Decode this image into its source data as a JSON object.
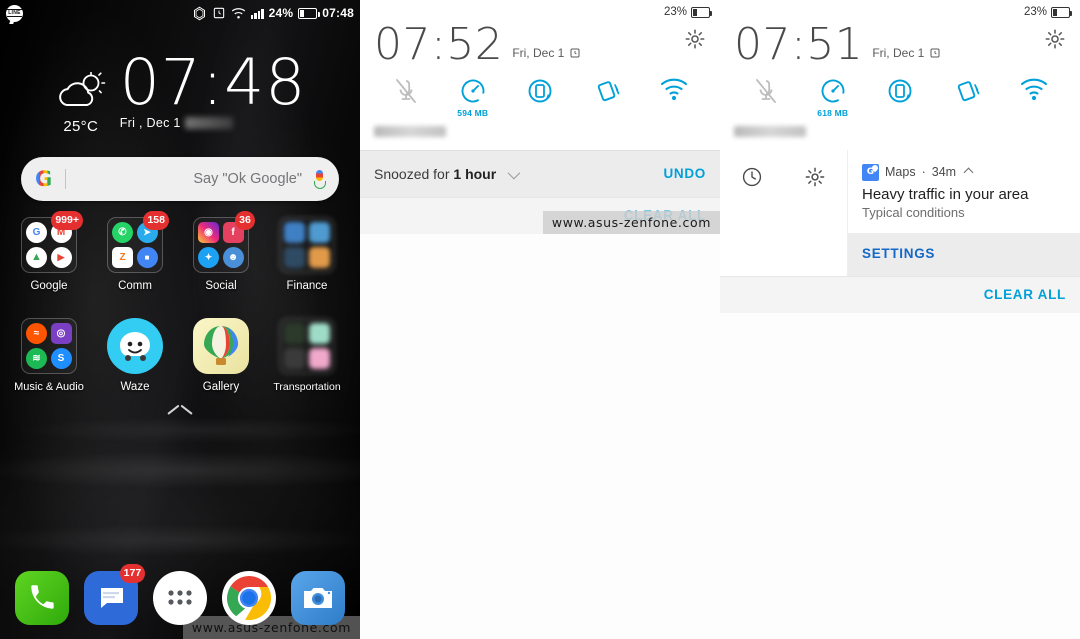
{
  "home": {
    "statusbar": {
      "notification_icon": "line-icon",
      "icons": [
        "do-not-disturb-icon",
        "alarm-icon",
        "wifi-icon",
        "signal-icon"
      ],
      "battery_percent": "24%",
      "time": "07:48"
    },
    "widget": {
      "weather_icon": "partly-cloudy-icon",
      "temperature": "25°C",
      "time": "07:48",
      "date": "Fri , Dec 1"
    },
    "search": {
      "logo": "google-g-icon",
      "placeholder": "Say \"Ok Google\"",
      "mic_icon": "microphone-icon"
    },
    "rows": [
      [
        {
          "label": "Google",
          "type": "folder",
          "badge": "999+",
          "minis": [
            {
              "name": "google-icon",
              "bg": "#ffffff",
              "fg": "#4285f4",
              "glyph": "G"
            },
            {
              "name": "gmail-icon",
              "bg": "#ffffff",
              "fg": "#ea4335",
              "glyph": "M"
            },
            {
              "name": "drive-icon",
              "bg": "#ffffff",
              "fg": "#34a853",
              "glyph": "▲"
            },
            {
              "name": "play-icon",
              "bg": "#ffffff",
              "fg": "#ea4335",
              "glyph": "▶"
            }
          ]
        },
        {
          "label": "Comm",
          "type": "folder",
          "badge": "158",
          "minis": [
            {
              "name": "whatsapp-icon",
              "bg": "#25d366",
              "fg": "#ffffff",
              "glyph": "✆"
            },
            {
              "name": "telegram-icon",
              "bg": "#2aabee",
              "fg": "#ffffff",
              "glyph": "➤"
            },
            {
              "name": "zalo-icon",
              "bg": "#ffffff",
              "fg": "#f47b20",
              "glyph": "Z"
            },
            {
              "name": "duo-icon",
              "bg": "#4285f4",
              "fg": "#ffffff",
              "glyph": "■"
            }
          ]
        },
        {
          "label": "Social",
          "type": "folder",
          "badge": "36",
          "minis": [
            {
              "name": "instagram-icon",
              "bg": "#d6306e",
              "fg": "#ffffff",
              "glyph": "◉"
            },
            {
              "name": "facebook-icon",
              "bg": "#e4405f",
              "fg": "#ffffff",
              "glyph": "f"
            },
            {
              "name": "twitter-icon",
              "bg": "#1da1f2",
              "fg": "#ffffff",
              "glyph": "✦"
            },
            {
              "name": "reddit-icon",
              "bg": "#4a90d9",
              "fg": "#ffffff",
              "glyph": "☻"
            }
          ]
        },
        {
          "label": "Finance",
          "type": "folder",
          "badge": "",
          "minis": [
            {
              "name": "finance-app-icon",
              "bg": "#3f7fc4",
              "fg": "#ffffff",
              "glyph": ""
            },
            {
              "name": "finance-app-icon",
              "bg": "#4f9ad0",
              "fg": "#ffffff",
              "glyph": ""
            },
            {
              "name": "finance-app-icon",
              "bg": "#2f4a63",
              "fg": "#ffffff",
              "glyph": ""
            },
            {
              "name": "finance-app-icon",
              "bg": "#e09a4a",
              "fg": "#ffffff",
              "glyph": ""
            }
          ]
        }
      ],
      [
        {
          "label": "Music & Audio",
          "type": "folder",
          "badge": "",
          "minis": [
            {
              "name": "soundcloud-icon",
              "bg": "#ff5500",
              "fg": "#ffffff",
              "glyph": "≈"
            },
            {
              "name": "podcast-icon",
              "bg": "#7b3fc4",
              "fg": "#ffffff",
              "glyph": "◎"
            },
            {
              "name": "spotify-icon",
              "bg": "#1db954",
              "fg": "#ffffff",
              "glyph": "≋"
            },
            {
              "name": "shazam-icon",
              "bg": "#1f8fff",
              "fg": "#ffffff",
              "glyph": "S"
            }
          ]
        },
        {
          "label": "Waze",
          "type": "app",
          "icon": "waze-icon",
          "bg": "#33ccf3",
          "glyph": "☺"
        },
        {
          "label": "Gallery",
          "type": "app",
          "icon": "gallery-icon",
          "bg": "#f3efbf",
          "glyph": ""
        },
        {
          "label": "Transportation",
          "type": "folder",
          "badge": "",
          "minis": [
            {
              "name": "transport-app-icon",
              "bg": "#2b3a2b",
              "fg": "#ffffff",
              "glyph": ""
            },
            {
              "name": "transport-app-icon",
              "bg": "#9fdcc8",
              "fg": "#ffffff",
              "glyph": ""
            },
            {
              "name": "transport-app-icon",
              "bg": "#3a3a3a",
              "fg": "#ffffff",
              "glyph": ""
            },
            {
              "name": "transport-app-icon",
              "bg": "#f0a8cb",
              "fg": "#ffffff",
              "glyph": ""
            }
          ]
        }
      ]
    ],
    "app_drawer_arrow": "chevron-up-icon",
    "dock": [
      {
        "name": "phone-icon",
        "bg": "#3fc018",
        "glyph": "✆",
        "badge": ""
      },
      {
        "name": "messages-icon",
        "bg": "#2f6ad9",
        "glyph": "▤",
        "badge": "177"
      },
      {
        "name": "app-drawer-icon",
        "bg": "#ffffff",
        "glyph": "",
        "badge": ""
      },
      {
        "name": "chrome-icon",
        "bg": "#ffffff",
        "glyph": "",
        "badge": ""
      },
      {
        "name": "camera-icon",
        "bg": "#3f8ede",
        "glyph": "◙",
        "badge": ""
      }
    ],
    "watermark": "www.asus-zenfone.com"
  },
  "shade_mid": {
    "battery_percent": "23%",
    "time": "07:52",
    "date": "Fri, Dec 1",
    "alarm_icon": "alarm-icon",
    "settings_icon": "gear-icon",
    "quick_settings": [
      {
        "name": "mute-icon",
        "sub": "",
        "active": false
      },
      {
        "name": "ram-boost-icon",
        "sub": "594 MB",
        "active": true
      },
      {
        "name": "auto-rotate-icon",
        "sub": "",
        "active": true
      },
      {
        "name": "screenshot-icon",
        "sub": "",
        "active": true
      },
      {
        "name": "wifi-icon",
        "sub": "",
        "active": true
      }
    ],
    "carrier": "",
    "snooze": {
      "prefix": "Snoozed for ",
      "duration": "1 hour",
      "chevron": "chevron-down-icon",
      "undo": "UNDO"
    },
    "clear_all": "CLEAR ALL",
    "watermark": "www.asus-zenfone.com"
  },
  "shade_right": {
    "battery_percent": "23%",
    "time": "07:51",
    "date": "Fri, Dec 1",
    "alarm_icon": "alarm-icon",
    "settings_icon": "gear-icon",
    "quick_settings": [
      {
        "name": "mute-icon",
        "sub": "",
        "active": false
      },
      {
        "name": "ram-boost-icon",
        "sub": "618 MB",
        "active": true
      },
      {
        "name": "auto-rotate-icon",
        "sub": "",
        "active": true
      },
      {
        "name": "screenshot-icon",
        "sub": "",
        "active": true
      },
      {
        "name": "wifi-icon",
        "sub": "",
        "active": true
      }
    ],
    "carrier": "",
    "swipe_actions": [
      {
        "name": "snooze-clock-icon"
      },
      {
        "name": "notification-settings-gear-icon"
      }
    ],
    "notification": {
      "app_icon": "google-maps-icon",
      "app_name": "Maps",
      "separator": "·",
      "time": "34m",
      "collapse_icon": "chevron-up-icon",
      "title": "Heavy traffic in your area",
      "subtitle": "Typical conditions",
      "action": "SETTINGS"
    },
    "clear_all": "CLEAR ALL"
  },
  "colors": {
    "accent_cyan": "#00a0d8",
    "accent_blue": "#1468c8",
    "badge_red": "#e53030"
  }
}
